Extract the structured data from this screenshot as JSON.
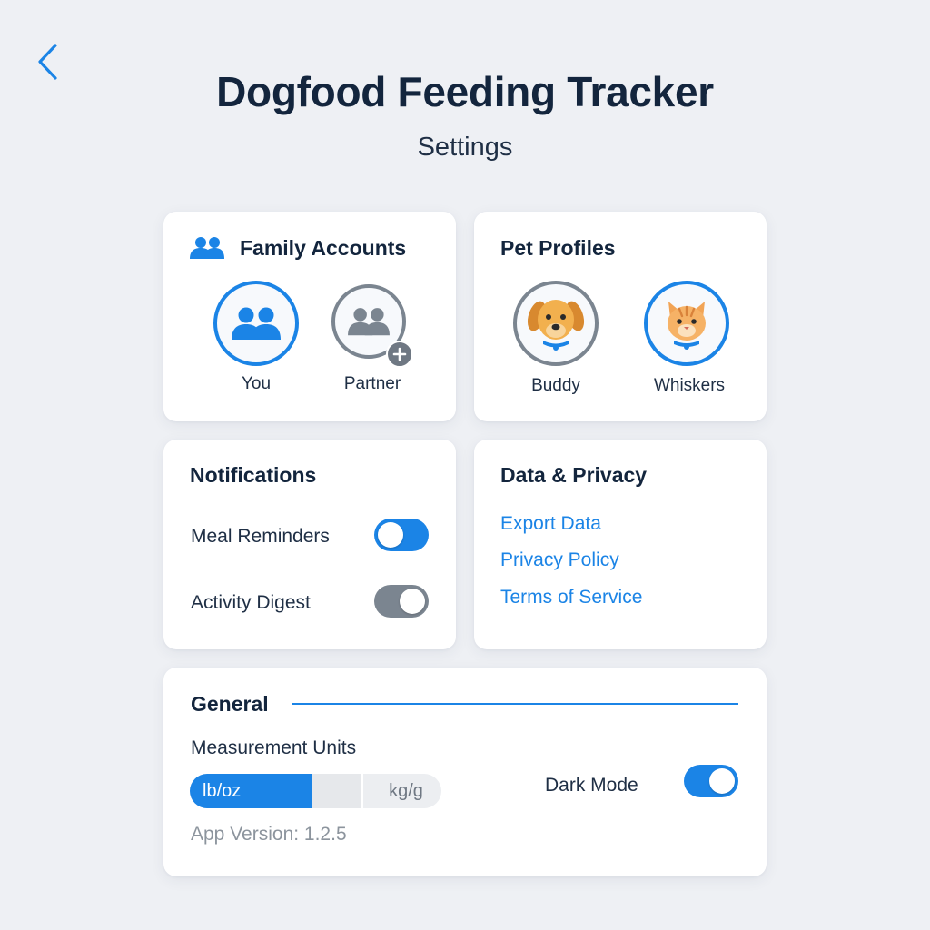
{
  "header": {
    "title": "Dogfood Feeding Tracker",
    "subtitle": "Settings",
    "back_icon": "chevron-left-icon"
  },
  "family": {
    "title": "Family Accounts",
    "icon": "people-icon",
    "members": [
      {
        "label": "You",
        "icon": "people-icon",
        "ring": "blue"
      },
      {
        "label": "Partner",
        "icon": "people-icon",
        "ring": "grey",
        "badge": "add-icon"
      }
    ]
  },
  "pets": {
    "title": "Pet Profiles",
    "profiles": [
      {
        "label": "Buddy",
        "icon": "dog-icon",
        "ring": "grey"
      },
      {
        "label": "Whiskers",
        "icon": "cat-icon",
        "ring": "blue"
      }
    ]
  },
  "notifications": {
    "title": "Notifications",
    "items": [
      {
        "label": "Meal Reminders",
        "state": "on"
      },
      {
        "label": "Activity Digest",
        "state": "off"
      }
    ]
  },
  "privacy": {
    "title": "Data & Privacy",
    "links": [
      "Export Data",
      "Privacy Policy",
      "Terms of Service"
    ]
  },
  "general": {
    "title": "General",
    "units_label": "Measurement Units",
    "units_options": [
      "lb/oz",
      "kg/g"
    ],
    "units_selected": "lb/oz",
    "dark_mode_label": "Dark Mode",
    "dark_mode_state": "on",
    "version": "App Version: 1.2.5"
  },
  "colors": {
    "accent": "#1b84e6",
    "inactive": "#7b8590",
    "text": "#13253d",
    "background": "#eef0f4"
  }
}
